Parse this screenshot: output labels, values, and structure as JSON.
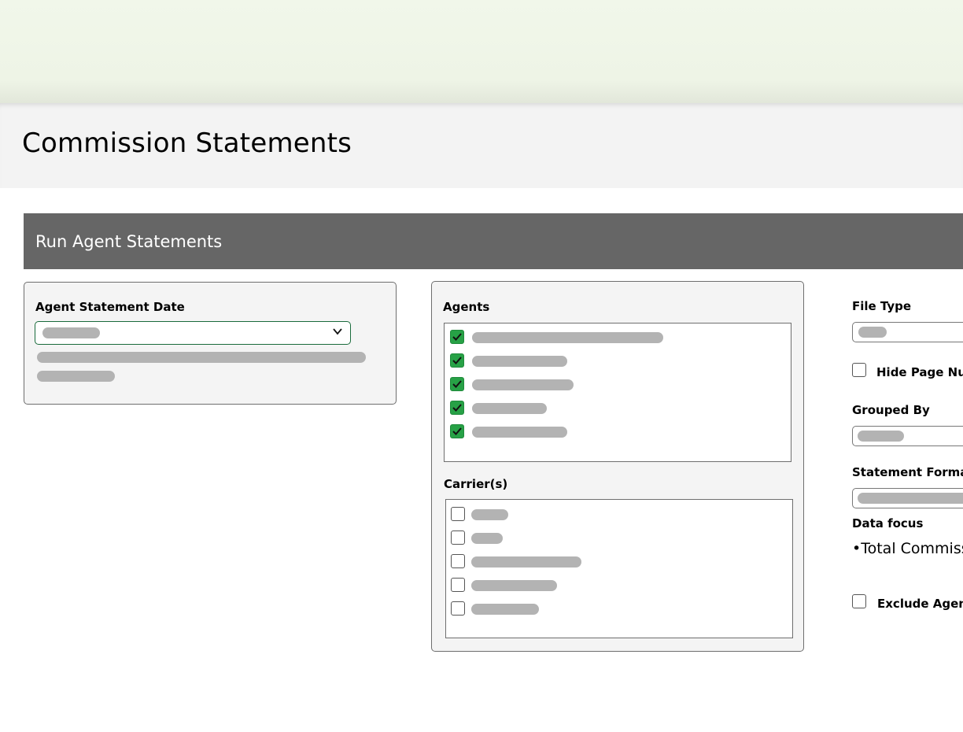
{
  "page": {
    "title": "Commission Statements"
  },
  "section": {
    "title": "Run Agent Statements"
  },
  "statement_date": {
    "label": "Agent Statement Date",
    "selected_value": ""
  },
  "agents": {
    "label": "Agents",
    "items": [
      {
        "label": "",
        "checked": true
      },
      {
        "label": "",
        "checked": true
      },
      {
        "label": "",
        "checked": true
      },
      {
        "label": "",
        "checked": true
      },
      {
        "label": "",
        "checked": true
      }
    ]
  },
  "carriers": {
    "label": "Carrier(s)",
    "items": [
      {
        "label": "",
        "checked": false
      },
      {
        "label": "",
        "checked": false
      },
      {
        "label": "",
        "checked": false
      },
      {
        "label": "",
        "checked": false
      },
      {
        "label": "",
        "checked": false
      }
    ]
  },
  "options": {
    "file_type_label": "File Type",
    "hide_page_numbers_label": "Hide Page Nu",
    "grouped_by_label": "Grouped By",
    "statement_format_label": "Statement Format",
    "data_focus_label": "Data focus",
    "data_focus_item": "Total Commiss",
    "exclude_label": "Exclude Agen"
  },
  "colors": {
    "header_band": "#f1f7ea",
    "title_bar": "#f3f3f3",
    "section_header": "#666666",
    "checkbox_checked": "#27a146",
    "select_border": "#1a6b3c",
    "placeholder": "#b3b3b3"
  }
}
